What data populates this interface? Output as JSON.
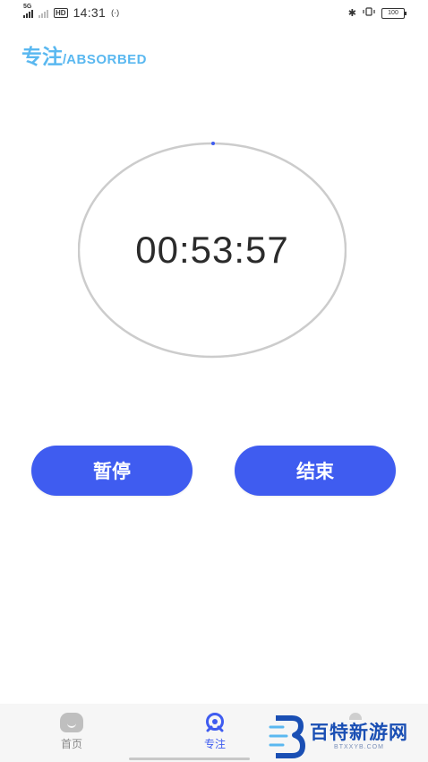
{
  "status_bar": {
    "network": "5G",
    "hd": "HD",
    "time": "14:31",
    "hotspot": "(·)",
    "bluetooth": "✱",
    "battery": "100"
  },
  "header": {
    "title": "专注",
    "separator": "/",
    "subtitle": "ABSORBED"
  },
  "timer": {
    "time": "00:53:57"
  },
  "actions": {
    "pause_label": "暂停",
    "end_label": "结束"
  },
  "nav": {
    "items": [
      {
        "label": "首页",
        "icon": "home-icon"
      },
      {
        "label": "专注",
        "icon": "focus-icon"
      },
      {
        "label": "",
        "icon": "profile-icon"
      }
    ]
  },
  "watermark": {
    "cn": "百特新游网",
    "en": "BTXXYB.COM"
  },
  "colors": {
    "accent": "#3f5cf0",
    "header": "#5ab8f0",
    "ring": "#cccccc",
    "watermark": "#1a4fb4"
  }
}
